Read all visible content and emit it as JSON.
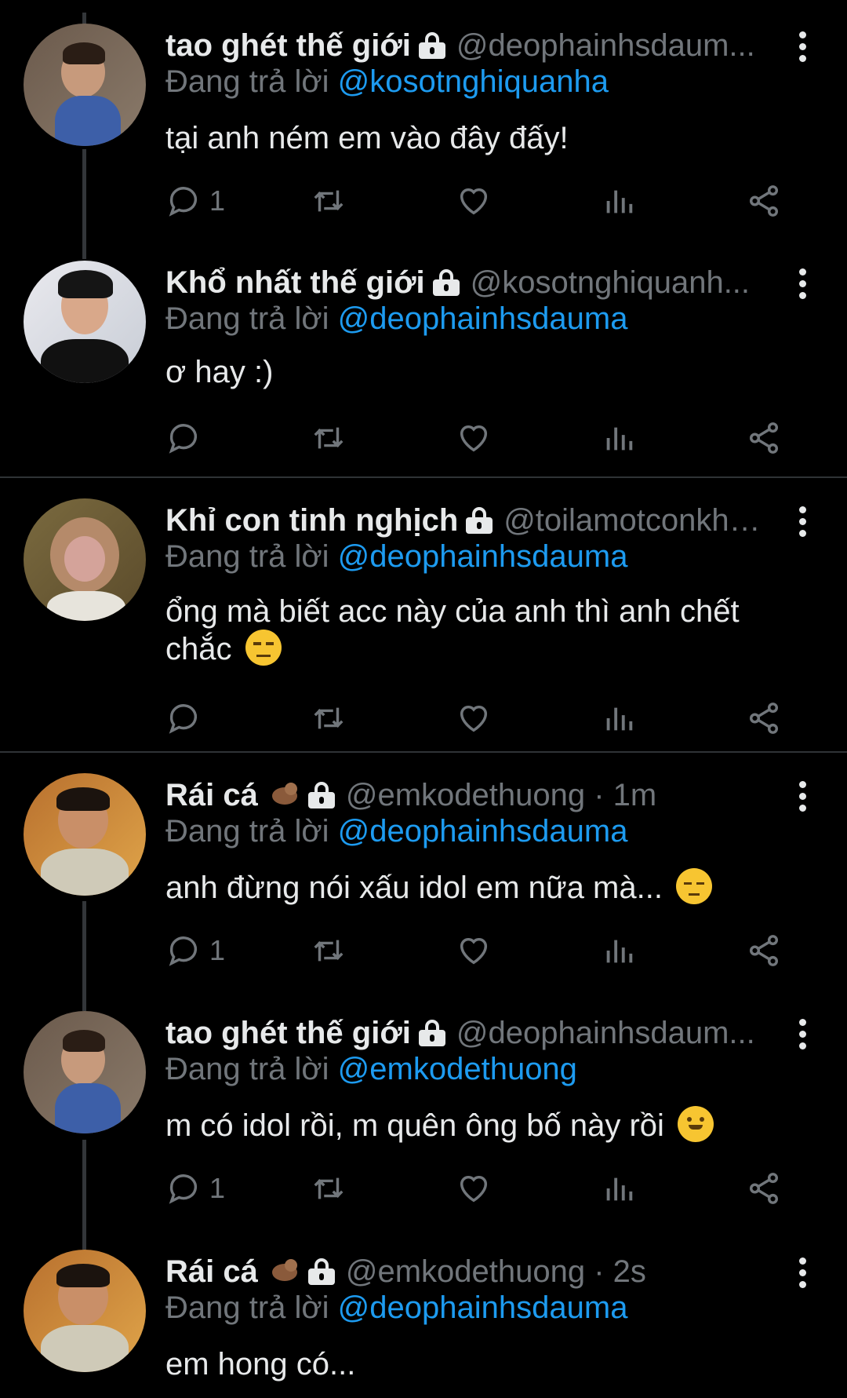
{
  "replying_prefix": "Đang trả lời",
  "tweets": [
    {
      "name": "tao ghét thế giới",
      "handle": "@deophainhsdaum...",
      "replying_to": "@kosotnghiquanha",
      "text": "tại anh ném em vào đây đấy!",
      "reply_count": "1"
    },
    {
      "name": "Khổ nhất thế giới",
      "handle": "@kosotnghiquanh...",
      "replying_to": "@deophainhsdauma",
      "text": "ơ hay :)",
      "reply_count": ""
    },
    {
      "name": "Khỉ con tinh nghịch",
      "handle": "@toilamotconkhi...",
      "replying_to": "@deophainhsdauma",
      "text_line1": "ổng mà biết acc này của anh thì anh chết",
      "text_line2": "chắc",
      "reply_count": ""
    },
    {
      "name": "Rái cá",
      "handle": "@emkodethuong · 1m",
      "replying_to": "@deophainhsdauma",
      "text": "anh đừng nói xấu idol em nữa mà...",
      "reply_count": "1"
    },
    {
      "name": "tao ghét thế giới",
      "handle": "@deophainhsdaum...",
      "replying_to": "@emkodethuong",
      "text": "m có idol rồi, m quên ông bố này rồi",
      "reply_count": "1"
    },
    {
      "name": "Rái cá",
      "handle": "@emkodethuong · 2s",
      "replying_to": "@deophainhsdauma",
      "text": "em hong có..."
    }
  ],
  "colors": {
    "background": "#000000",
    "text": "#e7e9ea",
    "secondary": "#71767b",
    "mention": "#1d9bf0"
  }
}
